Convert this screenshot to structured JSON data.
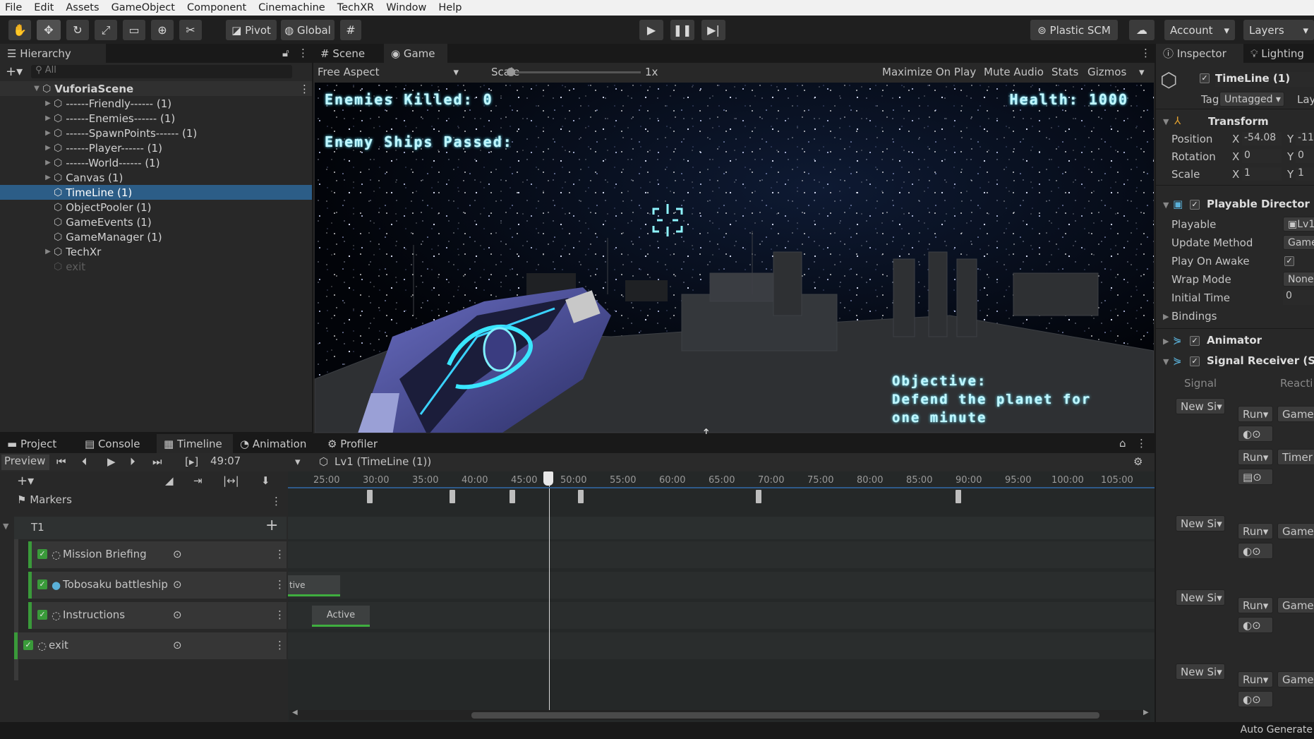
{
  "menu": [
    "File",
    "Edit",
    "Assets",
    "GameObject",
    "Component",
    "Cinemachine",
    "TechXR",
    "Window",
    "Help"
  ],
  "toolbar": {
    "pivot": "Pivot",
    "global": "Global",
    "plastic": "Plastic SCM",
    "account": "Account",
    "layers": "Layers"
  },
  "hierarchy": {
    "tab": "Hierarchy",
    "search": "All",
    "scene": "VuforiaScene",
    "items": [
      "------Friendly------ (1)",
      "------Enemies------ (1)",
      "------SpawnPoints------ (1)",
      "------Player------ (1)",
      "------World------ (1)",
      "Canvas (1)",
      "TimeLine (1)",
      "ObjectPooler (1)",
      "GameEvents (1)",
      "GameManager (1)",
      "TechXr",
      "exit"
    ]
  },
  "game_view": {
    "tab_scene": "Scene",
    "tab_game": "Game",
    "aspect": "Free Aspect",
    "scale_label": "Scale",
    "scale_value": "1x",
    "maximize": "Maximize On Play",
    "mute": "Mute Audio",
    "stats": "Stats",
    "gizmos": "Gizmos",
    "hud": {
      "enemies_killed": "Enemies Killed: 0",
      "health": "Health: 1000",
      "ships_passed": "Enemy Ships Passed:",
      "objective_1": "Objective:",
      "objective_2": "Defend the planet for",
      "objective_3": "one minute"
    }
  },
  "inspector": {
    "tab": "Inspector",
    "lighting": "Lighting",
    "object": "TimeLine (1)",
    "tag_label": "Tag",
    "tag": "Untagged",
    "layer_label": "Lay",
    "transform": "Transform",
    "position": "Position",
    "rotation": "Rotation",
    "scale": "Scale",
    "pos_x": "-54.08",
    "pos_y": "-11",
    "rot_x": "0",
    "rot_y": "0",
    "scale_x": "1",
    "scale_y": "1",
    "x": "X",
    "y": "Y",
    "director": "Playable Director",
    "playable": "Playable",
    "playable_val": "Lv1",
    "update_method": "Update Method",
    "update_val": "Game",
    "play_on_awake": "Play On Awake",
    "wrap_mode": "Wrap Mode",
    "wrap_val": "None",
    "initial_time": "Initial Time",
    "initial_val": "0",
    "bindings": "Bindings",
    "animator": "Animator",
    "signal_receiver": "Signal Receiver (Sc",
    "signal": "Signal",
    "reaction": "Reacti",
    "new_signal": "New Si",
    "runtime": "Run",
    "game": "Game",
    "timer": "Timer",
    "auto_generate": "Auto Generate"
  },
  "bottom": {
    "tabs": [
      "Project",
      "Console",
      "Timeline",
      "Animation",
      "Profiler"
    ],
    "preview": "Preview",
    "time": "49:07",
    "asset": "Lv1 (TimeLine (1))",
    "markers": "Markers",
    "group": "T1",
    "tracks": [
      "Mission Briefing",
      "Tobosaku battleship",
      "Instructions",
      "exit"
    ],
    "clip1": "tive",
    "clip2": "Active",
    "ticks": [
      "25:00",
      "30:00",
      "35:00",
      "40:00",
      "45:00",
      "50:00",
      "55:00",
      "60:00",
      "65:00",
      "70:00",
      "75:00",
      "80:00",
      "85:00",
      "90:00",
      "95:00",
      "100:00",
      "105:00"
    ]
  }
}
